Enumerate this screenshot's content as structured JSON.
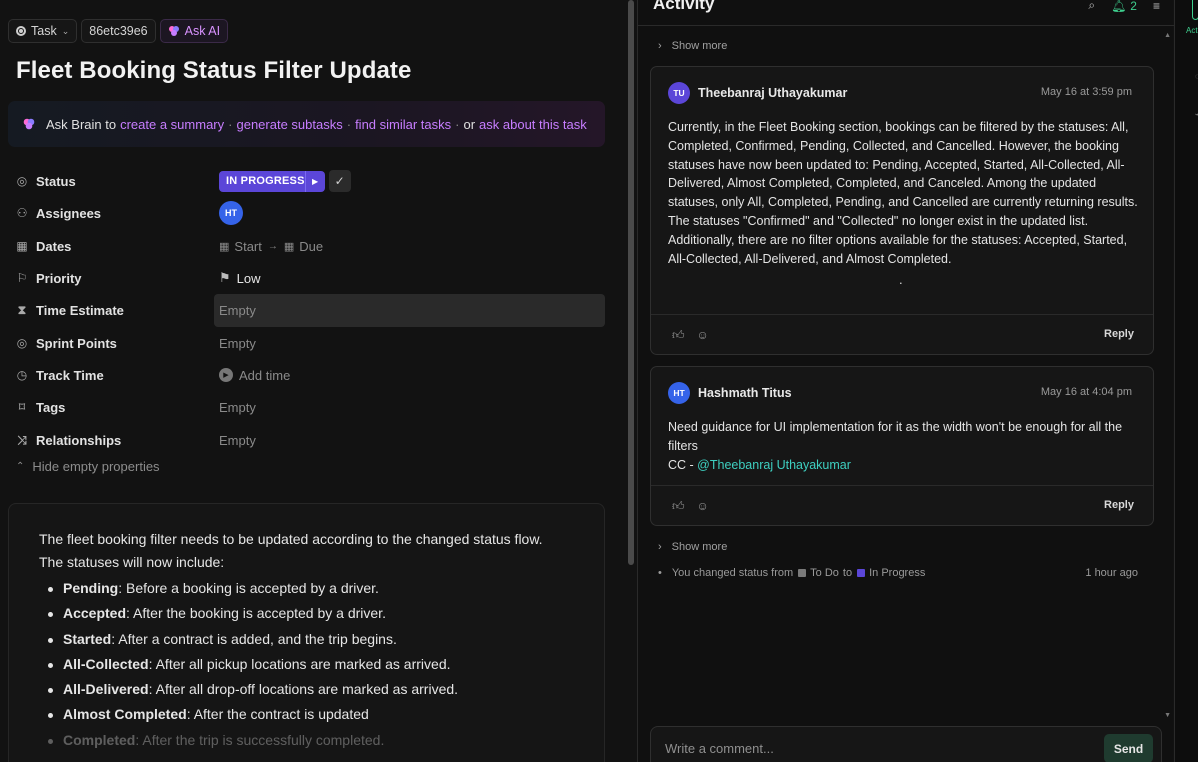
{
  "header": {
    "type_label": "Task",
    "task_id": "86etc39e6",
    "ask_ai_label": "Ask AI"
  },
  "task": {
    "title": "Fleet Booking Status Filter Update"
  },
  "brain": {
    "prefix": "Ask Brain to",
    "links": [
      "create a summary",
      "generate subtasks",
      "find similar tasks"
    ],
    "or_text": "or",
    "last_link": "ask about this task"
  },
  "properties": {
    "status": {
      "label": "Status",
      "value": "IN PROGRESS"
    },
    "assignees": {
      "label": "Assignees",
      "avatar": "HT"
    },
    "dates": {
      "label": "Dates",
      "start": "Start",
      "due": "Due"
    },
    "priority": {
      "label": "Priority",
      "value": "Low"
    },
    "time_estimate": {
      "label": "Time Estimate",
      "value": "Empty"
    },
    "sprint_points": {
      "label": "Sprint Points",
      "value": "Empty"
    },
    "track_time": {
      "label": "Track Time",
      "value": "Add time"
    },
    "tags": {
      "label": "Tags",
      "value": "Empty"
    },
    "relationships": {
      "label": "Relationships",
      "value": "Empty"
    },
    "hide_empty": "Hide empty properties"
  },
  "description": {
    "intro1": "The fleet booking filter needs to be updated according to the changed status flow.",
    "intro2": "The statuses will now include:",
    "items": [
      {
        "term": "Pending",
        "text": ": Before a booking is accepted by a driver."
      },
      {
        "term": "Accepted",
        "text": ": After the booking is accepted by a driver."
      },
      {
        "term": "Started",
        "text": ": After a contract is added, and the trip begins."
      },
      {
        "term": "All-Collected",
        "text": ": After all pickup locations are marked as arrived."
      },
      {
        "term": "All-Delivered",
        "text": ": After all drop-off locations are marked as arrived."
      },
      {
        "term": "Almost Completed",
        "text": ": After the contract is updated"
      },
      {
        "term": "Completed",
        "text": ": After the trip is successfully completed."
      }
    ]
  },
  "activity": {
    "title": "Activity",
    "notification_count": "2",
    "show_more": "Show more",
    "comments": [
      {
        "initials": "TU",
        "avatar_color": "#5b46d8",
        "author": "Theebanraj Uthayakumar",
        "date": "May 16 at 3:59 pm",
        "body": "Currently, in the Fleet Booking section, bookings can be filtered by the statuses: All, Completed, Confirmed, Pending, Collected, and Cancelled. However, the booking statuses have now been updated to: Pending, Accepted, Started, All-Collected, All-Delivered, Almost Completed, Completed, and Canceled. Among the updated statuses, only All, Completed, Pending, and Cancelled are currently returning results. The statuses \"Confirmed\" and \"Collected\" no longer exist in the updated list. Additionally, there are no filter options available for the statuses: Accepted, Started, All-Collected, All-Delivered, and Almost Completed.",
        "trailing": ".",
        "reply": "Reply"
      },
      {
        "initials": "HT",
        "avatar_color": "#3563e9",
        "author": "Hashmath Titus",
        "date": "May 16 at 4:04 pm",
        "body": "Need guidance for UI implementation for it as the width won't be enough for all the filters",
        "cc_prefix": "CC - ",
        "mention": "@Theebanraj Uthayakumar",
        "reply": "Reply"
      }
    ],
    "status_change": {
      "prefix": "You changed status from",
      "from": "To Do",
      "from_color": "#7a7a7a",
      "to_word": "to",
      "to": "In Progress",
      "to_color": "#5b46d8",
      "time": "1 hour ago"
    },
    "comment_placeholder": "Write a comment...",
    "send_label": "Send"
  },
  "sidebar": {
    "activity_label": "Acti"
  }
}
